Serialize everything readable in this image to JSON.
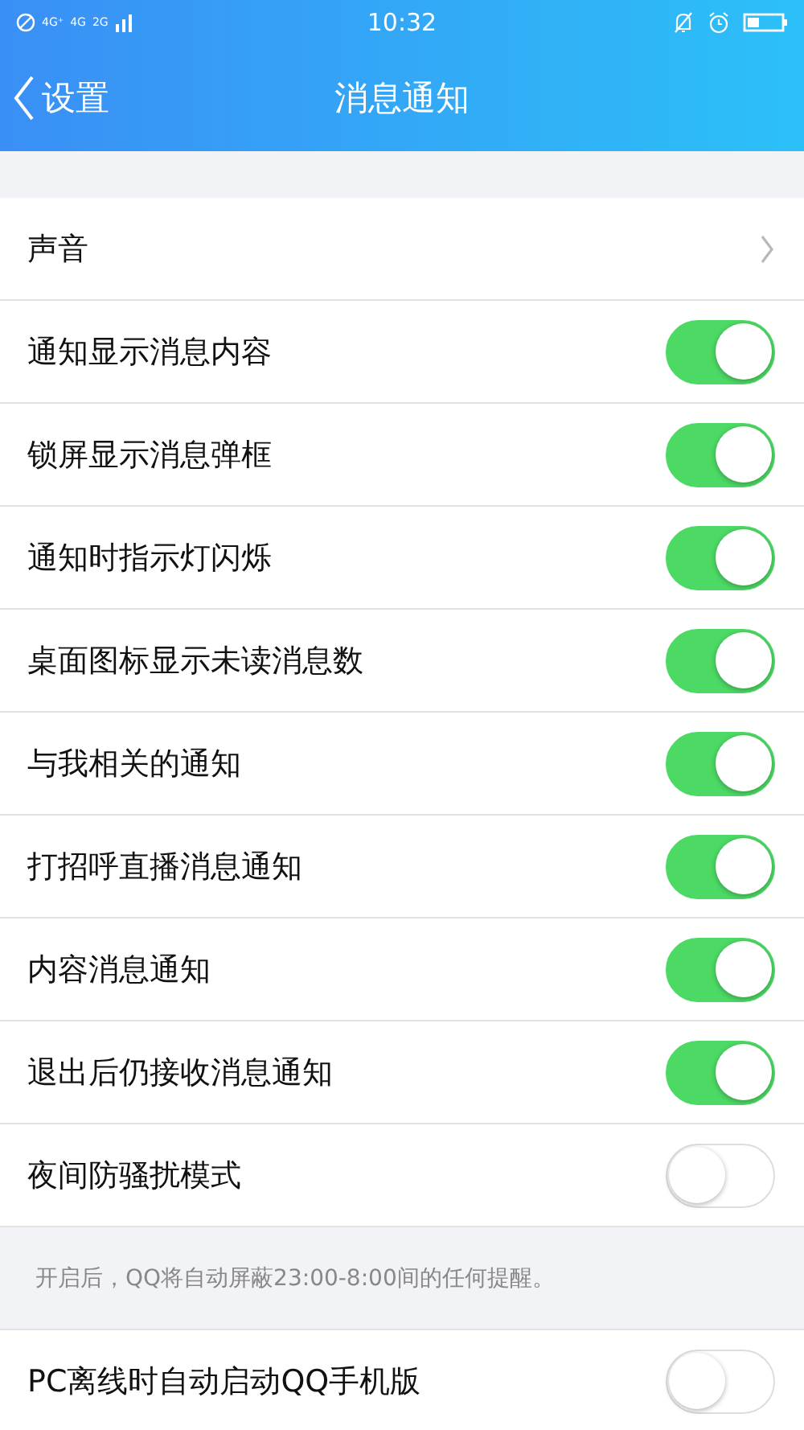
{
  "status_bar": {
    "networks": [
      "4G⁺",
      "4G",
      "2G"
    ],
    "time": "10:32"
  },
  "nav": {
    "back": "设置",
    "title": "消息通知"
  },
  "rows": [
    {
      "kind": "link",
      "label": "声音"
    },
    {
      "kind": "toggle",
      "label": "通知显示消息内容",
      "on": true
    },
    {
      "kind": "toggle",
      "label": "锁屏显示消息弹框",
      "on": true
    },
    {
      "kind": "toggle",
      "label": "通知时指示灯闪烁",
      "on": true
    },
    {
      "kind": "toggle",
      "label": "桌面图标显示未读消息数",
      "on": true
    },
    {
      "kind": "toggle",
      "label": "与我相关的通知",
      "on": true
    },
    {
      "kind": "toggle",
      "label": "打招呼直播消息通知",
      "on": true
    },
    {
      "kind": "toggle",
      "label": "内容消息通知",
      "on": true
    },
    {
      "kind": "toggle",
      "label": "退出后仍接收消息通知",
      "on": true
    },
    {
      "kind": "toggle",
      "label": "夜间防骚扰模式",
      "on": false
    },
    {
      "kind": "note",
      "label": "开启后，QQ将自动屏蔽23:00-8:00间的任何提醒。"
    },
    {
      "kind": "toggle",
      "label": "PC离线时自动启动QQ手机版",
      "on": false
    }
  ]
}
